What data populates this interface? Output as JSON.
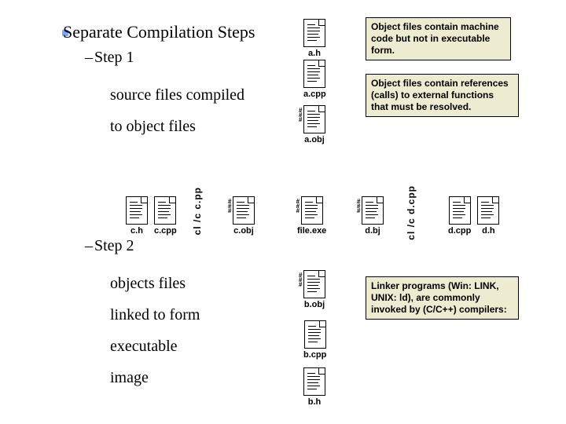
{
  "title": "Separate Compilation Steps",
  "step1": {
    "heading": "Step 1",
    "line1": "source files compiled",
    "line2": "to object files"
  },
  "step2": {
    "heading": "Step 2",
    "line1": "objects files",
    "line2": "linked to form",
    "line3": "executable",
    "line4": "image"
  },
  "notes": {
    "n1": "Object files contain machine code but not in executable form.",
    "n2": "Object files contain references (calls) to external functions that must be resolved.",
    "n3": "Linker programs (Win: LINK, UNIX: ld), are commonly invoked by (C/C++) compilers:"
  },
  "files": {
    "a_h": "a.h",
    "a_cpp": "a.cpp",
    "a_obj": "a.obj",
    "c_h": "c.h",
    "c_cpp": "c.cpp",
    "c_obj": "c.obj",
    "file_exe": "file.exe",
    "d_bj": "d.bj",
    "d_cpp": "d.cpp",
    "d_h": "d.h",
    "b_obj": "b.obj",
    "b_cpp": "b.cpp",
    "b_h": "b.h"
  },
  "cmds": {
    "cl_c_cpp": "cl /c c.pp",
    "cl_d_cpp": "cl /c d.cpp"
  }
}
